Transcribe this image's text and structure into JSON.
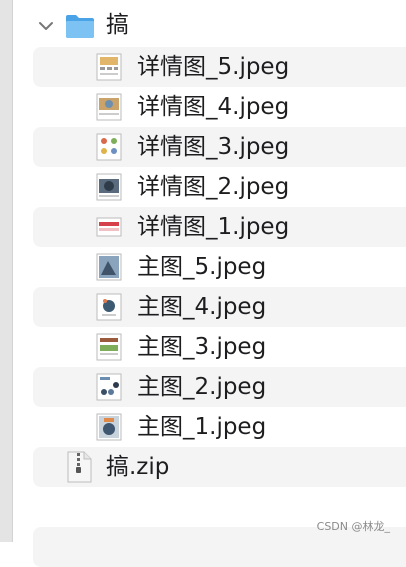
{
  "folder": {
    "name": "搞",
    "expanded": true,
    "icon": "folder-icon",
    "color": "#5fb2ec"
  },
  "files": [
    {
      "name": "详情图_5.jpeg",
      "thumb": "detail-5"
    },
    {
      "name": "详情图_4.jpeg",
      "thumb": "detail-4"
    },
    {
      "name": "详情图_3.jpeg",
      "thumb": "detail-3"
    },
    {
      "name": "详情图_2.jpeg",
      "thumb": "detail-2"
    },
    {
      "name": "详情图_1.jpeg",
      "thumb": "detail-1"
    },
    {
      "name": "主图_5.jpeg",
      "thumb": "main-5"
    },
    {
      "name": "主图_4.jpeg",
      "thumb": "main-4"
    },
    {
      "name": "主图_3.jpeg",
      "thumb": "main-3"
    },
    {
      "name": "主图_2.jpeg",
      "thumb": "main-2"
    },
    {
      "name": "主图_1.jpeg",
      "thumb": "main-1"
    }
  ],
  "zip": {
    "name": "搞.zip",
    "icon": "zip-archive-icon"
  },
  "watermark": "CSDN @林龙_"
}
